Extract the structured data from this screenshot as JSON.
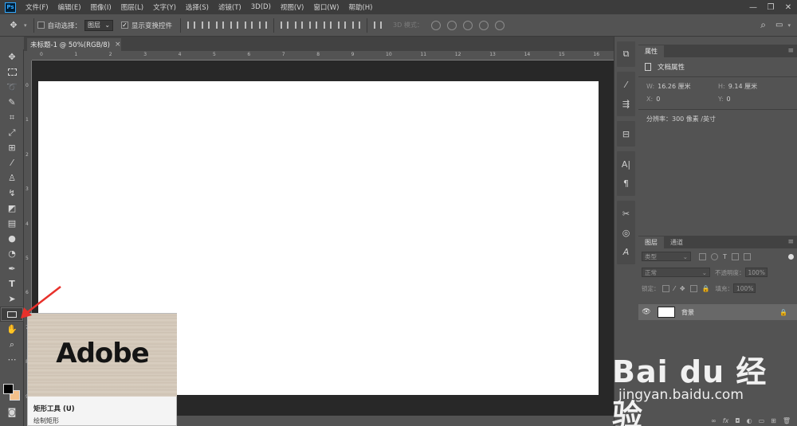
{
  "app": {
    "logo_text": "Ps"
  },
  "menu": [
    "文件(F)",
    "编辑(E)",
    "图像(I)",
    "图层(L)",
    "文字(Y)",
    "选择(S)",
    "滤镜(T)",
    "3D(D)",
    "视图(V)",
    "窗口(W)",
    "帮助(H)"
  ],
  "window_controls": {
    "minimize": "—",
    "restore": "❐",
    "close": "✕"
  },
  "options_bar": {
    "auto_select_label": "自动选择：",
    "auto_select_value": "图层",
    "show_transform_label": "显示变换控件",
    "show_transform_checked": true,
    "mode_3d_label": "3D 模式："
  },
  "document": {
    "tab_title": "未标题-1 @ 50%(RGB/8)",
    "close": "×"
  },
  "ruler": {
    "h_ticks": [
      "0",
      "1",
      "2",
      "3",
      "4",
      "5",
      "6",
      "7",
      "8",
      "9",
      "10",
      "11",
      "12",
      "13",
      "14",
      "15",
      "16"
    ],
    "v_ticks": [
      "0",
      "1",
      "2",
      "3",
      "4",
      "5",
      "6",
      "7",
      "8",
      "9"
    ]
  },
  "properties_panel": {
    "tab": "属性",
    "heading": "文档属性",
    "w_label": "W:",
    "w_value": "16.26 厘米",
    "h_label": "H:",
    "h_value": "9.14 厘米",
    "x_label": "X:",
    "x_value": "0",
    "y_label": "Y:",
    "y_value": "0",
    "resolution": "分辨率：300 像素 /英寸"
  },
  "layers_panel": {
    "tabs": [
      "图层",
      "通道"
    ],
    "filter_kind": "类型",
    "blend_mode": "正常",
    "opacity_label": "不透明度：",
    "opacity_value": "100%",
    "lock_label": "锁定：",
    "fill_label": "填充：",
    "fill_value": "100%",
    "layers": [
      {
        "name": "背景",
        "visible": true,
        "locked": true
      }
    ]
  },
  "tooltip": {
    "image_word": "Adobe",
    "title": "矩形工具 (U)",
    "description": "绘制矩形"
  },
  "watermark": {
    "logo": "Bai du 经验",
    "url": "jingyan.baidu.com"
  },
  "colors": {
    "accent": "#31a8ff",
    "foreground": "#000000",
    "background": "#f3c08a",
    "arrow": "#e8312b"
  }
}
